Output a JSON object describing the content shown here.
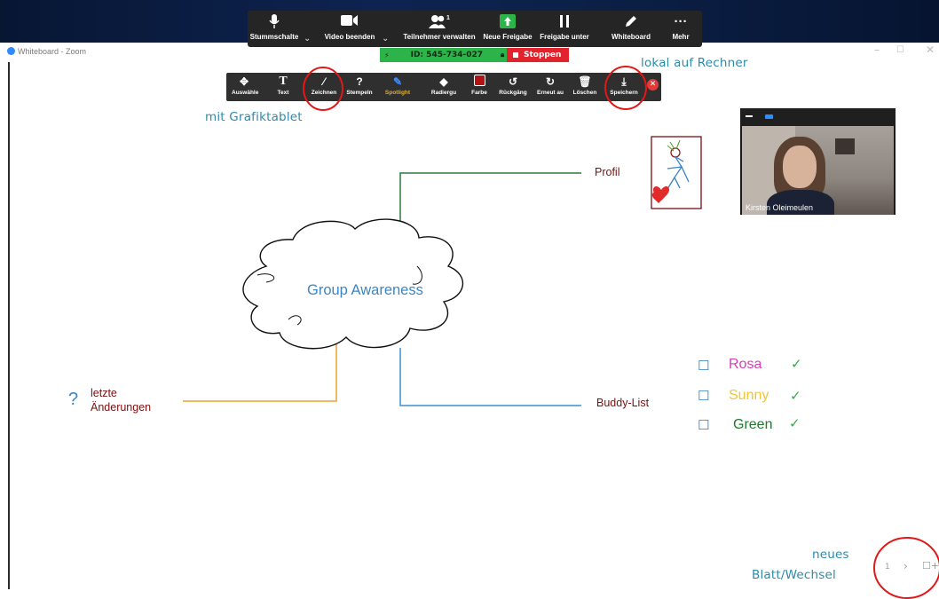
{
  "meeting_bar": {
    "items": [
      {
        "label": "Stummschalte",
        "icon": "microphone-icon"
      },
      {
        "label": "Video beenden",
        "icon": "video-camera-icon"
      },
      {
        "label": "Teilnehmer verwalten",
        "icon": "participants-icon",
        "count": "1"
      },
      {
        "label": "Neue Freigabe",
        "icon": "share-arrow-icon"
      },
      {
        "label": "Freigabe unter",
        "icon": "pause-icon"
      },
      {
        "label": "Whiteboard",
        "icon": "pen-icon"
      },
      {
        "label": "Mehr",
        "icon": "more-dots-icon"
      }
    ]
  },
  "status": {
    "meeting_id": "ID: 545-734-027",
    "stop_label": "Stoppen"
  },
  "window": {
    "title": "Whiteboard - Zoom"
  },
  "toolbar": {
    "items": [
      {
        "label": "Auswähle",
        "icon": "move-icon"
      },
      {
        "label": "Text",
        "icon": "text-icon"
      },
      {
        "label": "Zeichnen",
        "icon": "draw-line-icon"
      },
      {
        "label": "Stempeln",
        "icon": "stamp-question-icon"
      },
      {
        "label": "Spotlight",
        "icon": "spotlight-pen-icon"
      },
      {
        "label": "Radiergu",
        "icon": "eraser-icon"
      },
      {
        "label": "Farbe",
        "icon": "color-square-icon"
      },
      {
        "label": "Rückgäng",
        "icon": "undo-icon"
      },
      {
        "label": "Erneut au",
        "icon": "redo-icon"
      },
      {
        "label": "Löschen",
        "icon": "trash-icon"
      },
      {
        "label": "Speichern",
        "icon": "save-download-icon"
      }
    ]
  },
  "annotations": {
    "grafiktablet": "mit Grafiktablet",
    "rechner": "lokal auf Rechner",
    "neues_line1": "neues",
    "neues_line2": "Blatt/Wechsel"
  },
  "whiteboard": {
    "cloud_label": "Group Awareness",
    "profil": "Profil",
    "buddy_list": "Buddy-List",
    "letzte_line1": "letzte",
    "letzte_line2": "Änderungen",
    "question_mark": "?",
    "buddies": [
      {
        "name": "Rosa",
        "color": "#d63fb4"
      },
      {
        "name": "Sunny",
        "color": "#f2c634"
      },
      {
        "name": "Green",
        "color": "#1f7a2e"
      }
    ],
    "check_color": "#3aa84a"
  },
  "video": {
    "participant_name": "Kirsten Oleimeulen"
  },
  "pager": {
    "page": "1",
    "next": "›",
    "new_page": "☐+"
  },
  "colors": {
    "zoom_blue": "#2d8cff",
    "annotation": "#2e8aa8",
    "red_circle": "#e01818"
  }
}
